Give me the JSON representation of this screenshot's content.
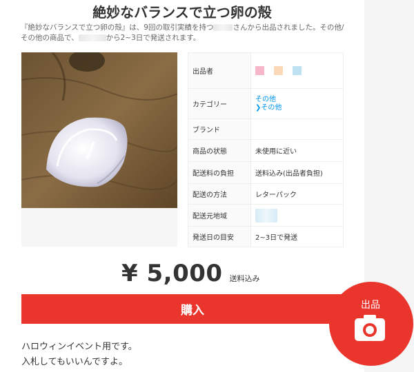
{
  "item": {
    "title": "絶妙なバランスで立つ卵の殻",
    "desc_part1": "『絶妙なバランスで立つ卵の殻』は、9回の取引実績を持つ",
    "desc_part2": "さんから出品されました。その他/",
    "desc_part3": "その他の商品で、",
    "desc_part4": "から2~3日で発送されます。",
    "photo_alt": "broken eggshell photo"
  },
  "specs": [
    {
      "label": "出品者",
      "value": ""
    },
    {
      "label": "カテゴリー",
      "value": "その他",
      "value2": "その他",
      "link_arrow": "❯"
    },
    {
      "label": "ブランド",
      "value": ""
    },
    {
      "label": "商品の状態",
      "value": "未使用に近い"
    },
    {
      "label": "配送料の負担",
      "value": "送料込み(出品者負担)"
    },
    {
      "label": "配送の方法",
      "value": "レターパック"
    },
    {
      "label": "配送元地域",
      "value": ""
    },
    {
      "label": "発送日の目安",
      "value": "2~3日で発送"
    }
  ],
  "price": {
    "amount": "¥ 5,000",
    "note": "送料込み"
  },
  "buy_label": "購入",
  "description_lines": [
    "ハロウィンイベント用です。",
    "入札してもいいんですよ。"
  ],
  "fab": {
    "label": "出品",
    "icon": "camera-icon"
  },
  "colors": {
    "accent": "#ea352d",
    "link": "#0095ee"
  }
}
